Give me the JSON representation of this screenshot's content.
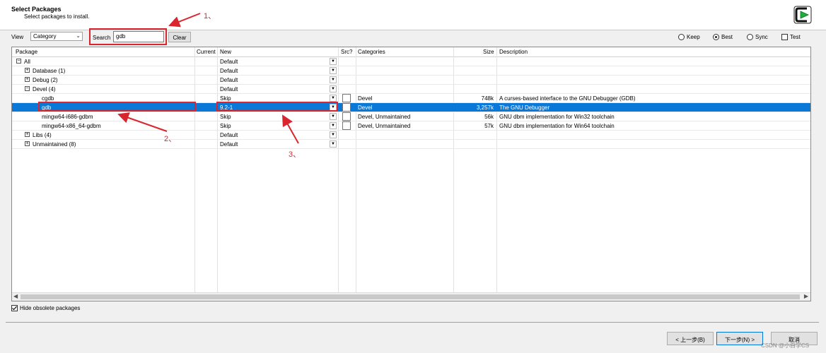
{
  "header": {
    "title": "Select Packages",
    "subtitle": "Select packages to install."
  },
  "toolbar": {
    "view_label": "View",
    "view_value": "Category",
    "search_label": "Search",
    "search_value": "gdb",
    "clear_label": "Clear",
    "radios": [
      {
        "label": "Keep",
        "selected": false
      },
      {
        "label": "Best",
        "selected": true
      },
      {
        "label": "Sync",
        "selected": false
      }
    ],
    "test_label": "Test"
  },
  "table": {
    "columns": [
      "Package",
      "Current",
      "New",
      "Src?",
      "Categories",
      "Size",
      "Description"
    ],
    "rows": [
      {
        "package": "All",
        "tree": "minus",
        "indent": 0,
        "current": "",
        "new": "Default",
        "src": false,
        "categories": "",
        "size": "",
        "description": "",
        "selected": false
      },
      {
        "package": "Database (1)",
        "tree": "plus",
        "indent": 1,
        "current": "",
        "new": "Default",
        "src": false,
        "categories": "",
        "size": "",
        "description": "",
        "selected": false
      },
      {
        "package": "Debug (2)",
        "tree": "plus",
        "indent": 1,
        "current": "",
        "new": "Default",
        "src": false,
        "categories": "",
        "size": "",
        "description": "",
        "selected": false
      },
      {
        "package": "Devel (4)",
        "tree": "minus",
        "indent": 1,
        "current": "",
        "new": "Default",
        "src": false,
        "categories": "",
        "size": "",
        "description": "",
        "selected": false
      },
      {
        "package": "cgdb",
        "tree": "",
        "indent": 2,
        "current": "",
        "new": "Skip",
        "src": true,
        "categories": "Devel",
        "size": "748k",
        "description": "A curses-based interface to the GNU Debugger (GDB)",
        "selected": false
      },
      {
        "package": "gdb",
        "tree": "",
        "indent": 2,
        "current": "",
        "new": "9.2-1",
        "src": true,
        "categories": "Devel",
        "size": "3,257k",
        "description": "The GNU Debugger",
        "selected": true
      },
      {
        "package": "mingw64-i686-gdbm",
        "tree": "",
        "indent": 2,
        "current": "",
        "new": "Skip",
        "src": true,
        "categories": "Devel, Unmaintained",
        "size": "56k",
        "description": "GNU dbm implementation for Win32 toolchain",
        "selected": false
      },
      {
        "package": "mingw64-x86_64-gdbm",
        "tree": "",
        "indent": 2,
        "current": "",
        "new": "Skip",
        "src": true,
        "categories": "Devel, Unmaintained",
        "size": "57k",
        "description": "GNU dbm implementation for Win64 toolchain",
        "selected": false
      },
      {
        "package": "Libs (4)",
        "tree": "plus",
        "indent": 1,
        "current": "",
        "new": "Default",
        "src": false,
        "categories": "",
        "size": "",
        "description": "",
        "selected": false
      },
      {
        "package": "Unmaintained (8)",
        "tree": "plus",
        "indent": 1,
        "current": "",
        "new": "Default",
        "src": false,
        "categories": "",
        "size": "",
        "description": "",
        "selected": false
      }
    ]
  },
  "annotations": [
    "1、",
    "2、",
    "3、"
  ],
  "hide_obsolete_label": "Hide obsolete packages",
  "footer": {
    "back_label": "< 上一步(B)",
    "next_label": "下一步(N) >",
    "cancel_label": "取消"
  },
  "watermark": "CSDN @小白学CS",
  "colors": {
    "selection": "#0a78d7",
    "annotation": "#d9262e",
    "logo_green": "#1fae3c"
  }
}
